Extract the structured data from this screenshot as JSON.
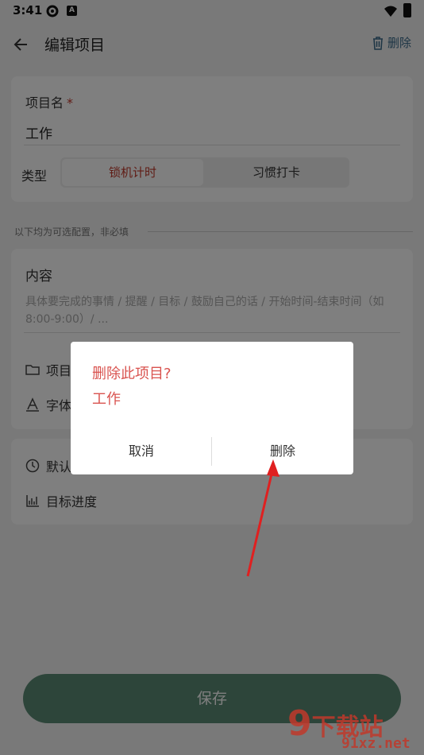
{
  "status": {
    "time": "3:41",
    "icon2_letter": "A"
  },
  "appbar": {
    "title": "编辑项目",
    "delete_label": "删除"
  },
  "form": {
    "name_label": "项目名",
    "required_mark": "*",
    "name_value": "工作",
    "type_label": "类型",
    "type_options": [
      "锁机计时",
      "习惯打卡"
    ],
    "optional_hint": "以下均为可选配置，非必填",
    "content_label": "内容",
    "content_placeholder": "具体要完成的事情 / 提醒 / 目标 / 鼓励自己的话 / 开始时间-结束时间（如8:00-9:00）/ ...",
    "row_project_partial": "项目",
    "row_font_partial": "字体",
    "row_default_partial": "默认",
    "row_progress": "目标进度"
  },
  "save_label": "保存",
  "dialog": {
    "title": "删除此项目?",
    "subtitle": "工作",
    "cancel_label": "取消",
    "confirm_label": "删除"
  },
  "watermark": {
    "main": "下载站",
    "url": "91xz.net",
    "glyph": "9"
  },
  "colors": {
    "accent_red": "#d9534f",
    "save_green": "#5b8a74",
    "link_blue": "#3a6a8a"
  }
}
